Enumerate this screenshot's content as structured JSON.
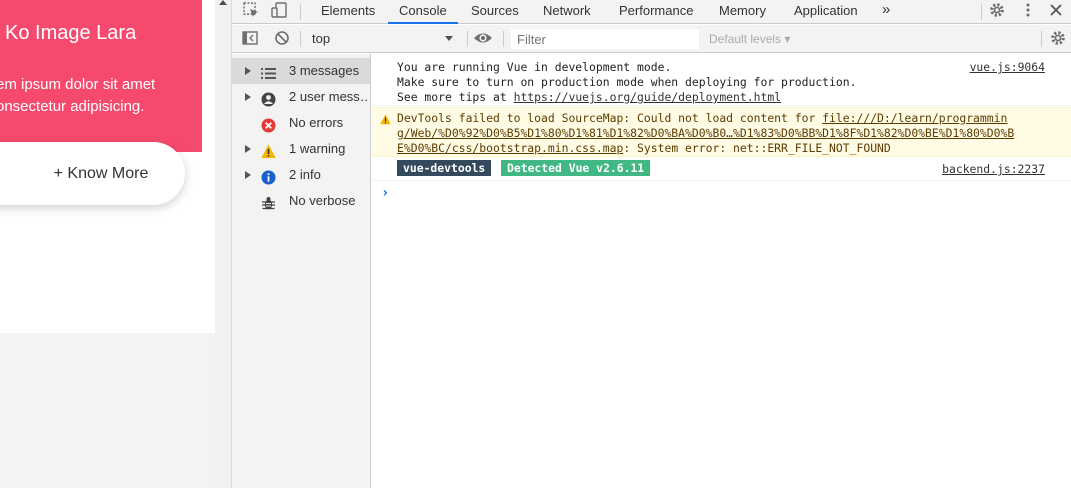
{
  "webpage": {
    "hero_title": "Ko Image Lara",
    "hero_line1": "em ipsum dolor sit amet",
    "hero_line2": "onsectetur adipisicing.",
    "know_more_button": "+ Know More"
  },
  "devtools": {
    "tabs": [
      {
        "label": "Elements",
        "active": false
      },
      {
        "label": "Console",
        "active": true
      },
      {
        "label": "Sources",
        "active": false
      },
      {
        "label": "Network",
        "active": false
      },
      {
        "label": "Performance",
        "active": false
      },
      {
        "label": "Memory",
        "active": false
      },
      {
        "label": "Application",
        "active": false
      }
    ],
    "more_tabs": "»",
    "toolbar": {
      "context": "top",
      "filter_placeholder": "Filter",
      "levels": "Default levels ▾"
    },
    "sidebar": [
      {
        "label": "3 messages",
        "icon": "list-icon"
      },
      {
        "label": "2 user mess…",
        "icon": "user-icon"
      },
      {
        "label": "No errors",
        "icon": "error-icon"
      },
      {
        "label": "1 warning",
        "icon": "warning-icon"
      },
      {
        "label": "2 info",
        "icon": "info-icon"
      },
      {
        "label": "No verbose",
        "icon": "bug-icon"
      }
    ],
    "messages": {
      "vue_dev": {
        "lines": [
          "You are running Vue in development mode.",
          "Make sure to turn on production mode when deploying for production.",
          "See more tips at "
        ],
        "link": "https://vuejs.org/guide/deployment.html",
        "source": "vue.js:9064"
      },
      "warning": {
        "prefix": "DevTools failed to load SourceMap: Could not load content for ",
        "url_part1": "file:///D:/learn/programmin",
        "url_part2": "g/Web/%D0%92%D0%B5%D1%80%D1%81%D1%82%D0%BA%D0%B0…%D1%83%D0%BB%D1%8F%D1%82%D0%BE%D1%80%D0%B",
        "url_part3": "E%D0%BC/css/bootstrap.min.css.map",
        "suffix": ": System error: net::ERR_FILE_NOT_FOUND"
      },
      "devtools_badge": {
        "label1": "vue-devtools",
        "label2": "Detected Vue v2.6.11",
        "source": "backend.js:2237"
      }
    },
    "prompt": "›",
    "colors": {
      "accent": "#1a73e8",
      "hero": "#f54a6e",
      "badge_dark": "#35495e",
      "badge_green": "#41b883",
      "warning_bg": "#fffbe5"
    }
  }
}
